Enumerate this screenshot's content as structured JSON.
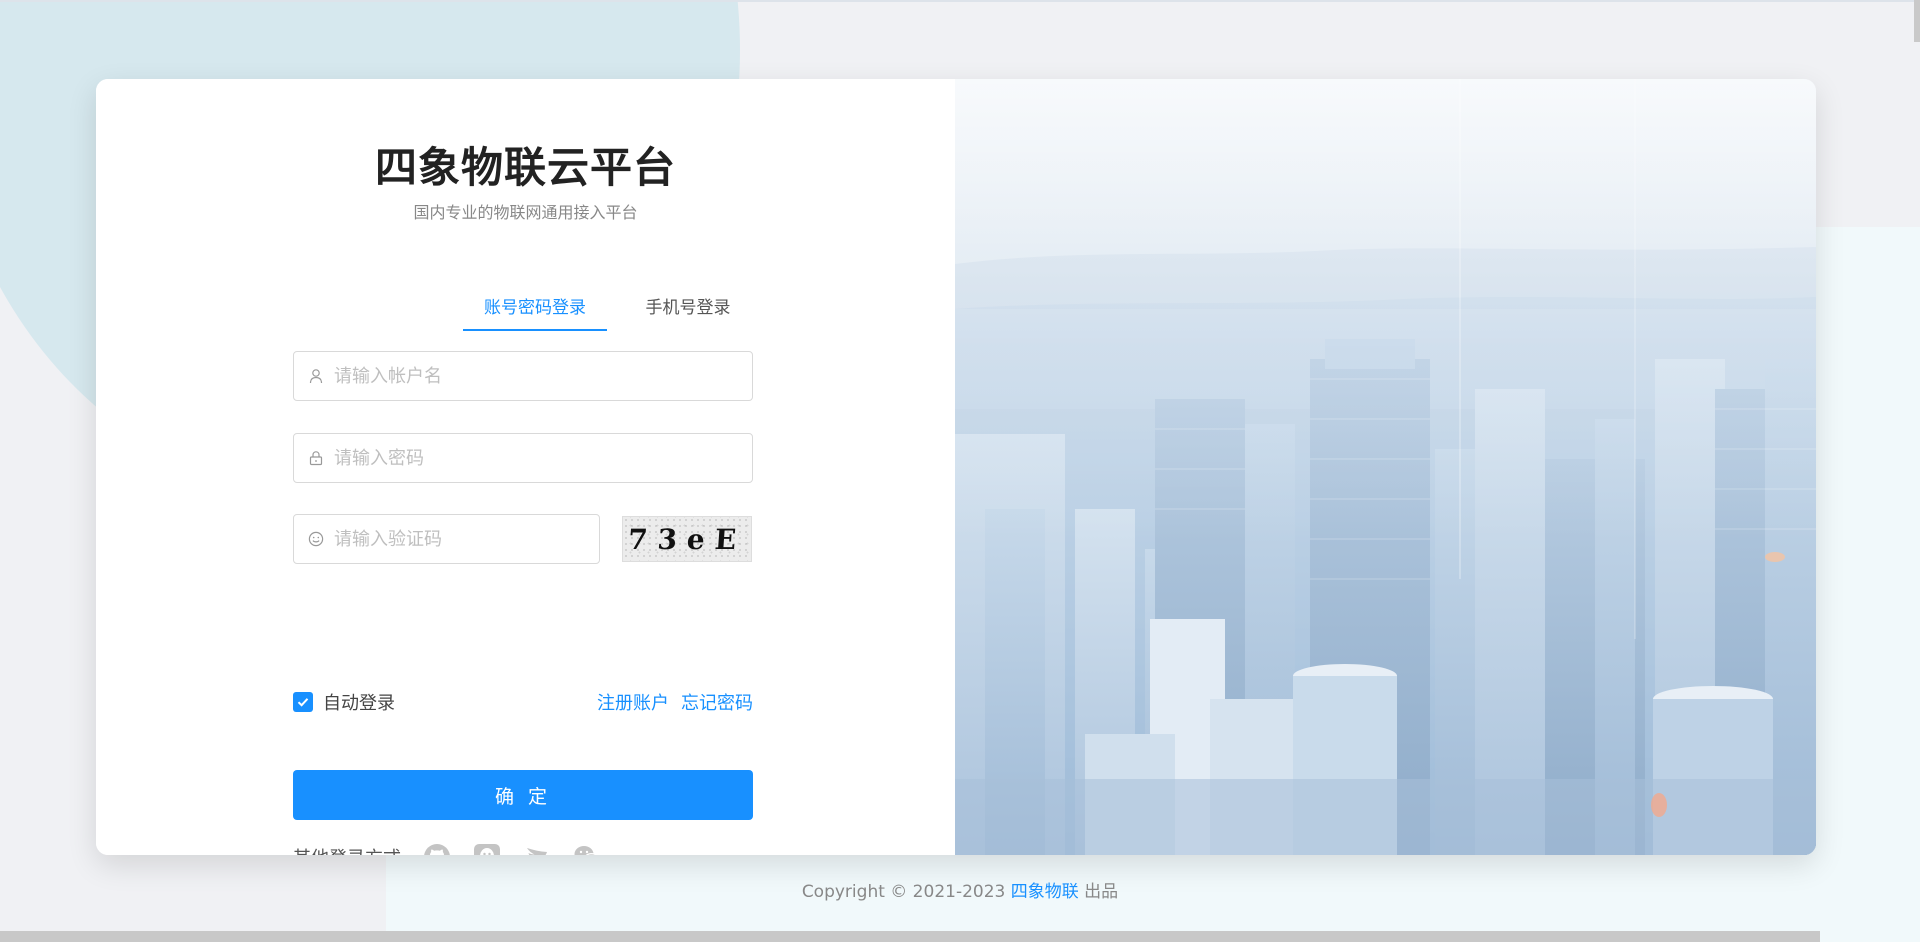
{
  "brand": {
    "title": "四象物联云平台",
    "subtitle": "国内专业的物联网通用接入平台"
  },
  "tabs": {
    "account": "账号密码登录",
    "phone": "手机号登录",
    "active": "account"
  },
  "form": {
    "username_placeholder": "请输入帐户名",
    "password_placeholder": "请输入密码",
    "captcha_placeholder": "请输入验证码",
    "captcha_text": "73eE",
    "auto_login_label": "自动登录",
    "auto_login_checked": true,
    "register_link": "注册账户",
    "forgot_link": "忘记密码",
    "submit_label": "确 定"
  },
  "other_login": {
    "label": "其他登录方式",
    "icons": [
      "github-icon",
      "qq-icon",
      "dingtalk-icon",
      "wechat-icon"
    ]
  },
  "footer": {
    "prefix": "Copyright © 2021-2023 ",
    "brand": "四象物联",
    "suffix": " 出品"
  },
  "colors": {
    "primary": "#1890ff",
    "background": "#f0f1f4",
    "card": "#ffffff",
    "accent_circle": "#d6e8ee"
  }
}
